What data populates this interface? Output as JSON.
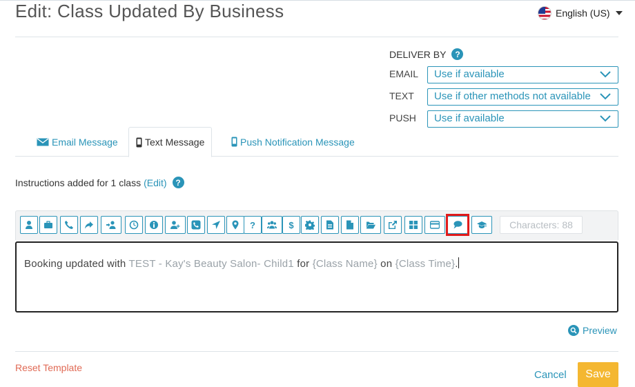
{
  "header": {
    "title": "Edit: Class Updated By Business",
    "language": "English (US)"
  },
  "deliver_by": {
    "title": "DELIVER BY",
    "rows": [
      {
        "label": "EMAIL",
        "value": "Use if available"
      },
      {
        "label": "TEXT",
        "value": "Use if other methods not available"
      },
      {
        "label": "PUSH",
        "value": "Use if available"
      }
    ]
  },
  "tabs": [
    {
      "label": "Email Message",
      "icon": "envelope-icon",
      "active": false
    },
    {
      "label": "Text Message",
      "icon": "mobile-phone-icon",
      "active": true
    },
    {
      "label": "Push Notification Message",
      "icon": "mobile-phone-icon",
      "active": false
    }
  ],
  "instructions": {
    "text": "Instructions added for 1 class",
    "edit_label": "(Edit)"
  },
  "toolbar": {
    "buttons": [
      "user-icon",
      "briefcase-icon",
      "phone-icon",
      "share-icon",
      "user-transfer-icon",
      "clock-icon",
      "info-icon",
      "user-plus-icon",
      "phone-square-icon",
      "location-arrow-icon",
      "map-marker-icon",
      "question-icon",
      "users-icon",
      "dollar-icon",
      "gear-icon",
      "file-text-icon",
      "file-icon",
      "folder-open-icon",
      "external-link-icon",
      "grid-icon",
      "credit-card-icon",
      "comments-icon",
      "graduation-cap-icon"
    ],
    "highlighted": "comments-icon",
    "characters_label": "Characters: 88"
  },
  "message": {
    "prefix": "Booking updated with ",
    "business": "TEST - Kay's Beauty Salon- Child1",
    "mid1": " for ",
    "class_name": "{Class Name}",
    "mid2": " on ",
    "class_time": "{Class Time}",
    "suffix": "."
  },
  "footer": {
    "preview": "Preview",
    "reset": "Reset Template",
    "cancel": "Cancel",
    "save": "Save"
  },
  "colors": {
    "accent": "#2a94b8",
    "save": "#f4b731",
    "reset": "#e06a55",
    "highlight": "#e11a1a"
  }
}
